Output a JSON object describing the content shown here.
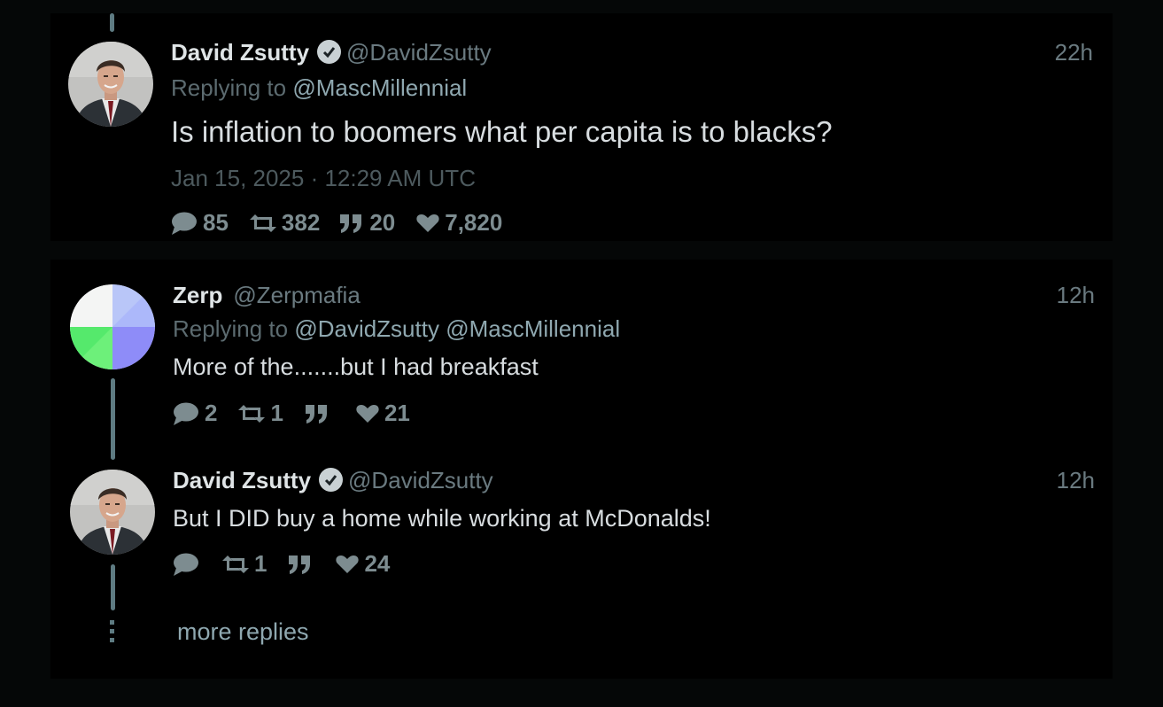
{
  "tweets": [
    {
      "fullname": "David Zsutty",
      "username": "@DavidZsutty",
      "verified": true,
      "time": "22h",
      "replying_label": "Replying to",
      "replying_to": [
        "@MascMillennial"
      ],
      "content": "Is inflation to boomers what per capita is to blacks?",
      "date": "Jan 15, 2025 · 12:29 AM UTC",
      "stats": {
        "replies": "85",
        "retweets": "382",
        "quotes": "20",
        "likes": "7,820"
      }
    },
    {
      "fullname": "Zerp",
      "username": "@Zerpmafia",
      "verified": false,
      "time": "12h",
      "replying_label": "Replying to",
      "replying_to": [
        "@DavidZsutty",
        "@MascMillennial"
      ],
      "content": "More of the.......but I had breakfast",
      "stats": {
        "replies": "2",
        "retweets": "1",
        "quotes": "",
        "likes": "21"
      }
    },
    {
      "fullname": "David Zsutty",
      "username": "@DavidZsutty",
      "verified": true,
      "time": "12h",
      "content": "But I DID buy a home while working at McDonalds!",
      "stats": {
        "replies": "",
        "retweets": "1",
        "quotes": "",
        "likes": "24"
      }
    }
  ],
  "more_replies_label": "more replies",
  "colors": {
    "background": "#050707",
    "panel": "#000000",
    "thread_line": "#5e7b82",
    "link": "#8fa8b0",
    "muted": "#6a7a80",
    "stat": "#7d8c90"
  }
}
